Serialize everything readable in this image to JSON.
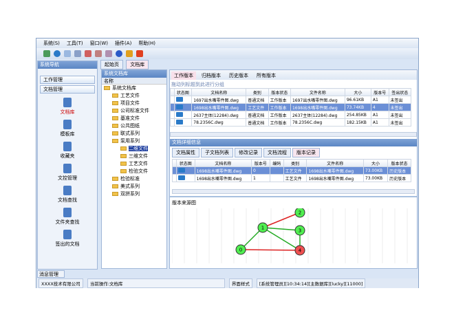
{
  "menu": [
    "系统(S)",
    "工具(T)",
    "窗口(W)",
    "插件(A)",
    "帮助(H)"
  ],
  "nav": {
    "title": "系统导航",
    "groups": [
      "工作管理",
      "文档管理"
    ],
    "items": [
      "文档库",
      "模板库",
      "收藏夹",
      "文控管理",
      "文档查找",
      "文件夹查找",
      "签出的文档"
    ],
    "bottom_tab": "消息管理"
  },
  "tabs": [
    "起始页",
    "文档库"
  ],
  "tree": {
    "title": "系统文档库",
    "header": "名称",
    "items": [
      {
        "label": "系统文档库",
        "level": 0
      },
      {
        "label": "工艺文件",
        "level": 1
      },
      {
        "label": "项目文件",
        "level": 1
      },
      {
        "label": "公司标准文件",
        "level": 1
      },
      {
        "label": "基准文件",
        "level": 1
      },
      {
        "label": "公共图纸",
        "level": 1
      },
      {
        "label": "联式系列",
        "level": 1
      },
      {
        "label": "泵用系列",
        "level": 1
      },
      {
        "label": "二维文件",
        "level": 2,
        "selected": true
      },
      {
        "label": "三维文件",
        "level": 2
      },
      {
        "label": "工艺文件",
        "level": 2
      },
      {
        "label": "检验文件",
        "level": 2
      },
      {
        "label": "检验标准",
        "level": 1
      },
      {
        "label": "美式系列",
        "level": 1
      },
      {
        "label": "双拼系列",
        "level": 1
      }
    ]
  },
  "versions": {
    "buttons": [
      "工作版本",
      "归档版本",
      "历史版本",
      "所有版本"
    ],
    "group_hint": "拖动列标题到此进行分组",
    "columns": [
      "状态图",
      "文档名称",
      "类别",
      "版本状态",
      "文件名称",
      "大小",
      "版本号",
      "签出状态"
    ],
    "rows": [
      [
        "",
        "1697出水嘴零件图.dwg",
        "普通文档",
        "工作版本",
        "1697出水嘴零件图.dwg",
        "96.61KB",
        "A1",
        "未签出"
      ],
      [
        "",
        "1698出水嘴零件图.dwg",
        "工艺文件",
        "工作版本",
        "1698出水嘴零件图.dwg",
        "73.74KB",
        "4",
        "未签出"
      ],
      [
        "",
        "2637主体(12284).dwg",
        "普通文档",
        "工作版本",
        "2637主体(12284).dwg",
        "254.85KB",
        "A1",
        "未签出"
      ],
      [
        "",
        "78.2356C.dwg",
        "普通文档",
        "工作版本",
        "78.2356C.dwg",
        "182.15KB",
        "A1",
        "未签出"
      ]
    ],
    "selected_row": 1
  },
  "detail": {
    "title": "文档详细信息",
    "tabs": [
      "文档属性",
      "子文档列表",
      "修改记录",
      "文档流程",
      "版本记录"
    ],
    "active_tab": 4,
    "columns": [
      "状态图",
      "文档名称",
      "版本号",
      "编码",
      "类别",
      "文件名称",
      "大小",
      "版本状态"
    ],
    "rows": [
      [
        "",
        "1698出水嘴零件图.dwg",
        "0",
        "",
        "工艺文件",
        "1698出水嘴零件图.dwg",
        "73.00KB",
        "历史版本"
      ],
      [
        "",
        "1698出水嘴零件图.dwg",
        "1",
        "",
        "工艺文件",
        "1698出水嘴零件图.dwg",
        "73.00KB",
        "历史版本"
      ]
    ],
    "graph_title": "版本来源图",
    "graph": {
      "nodes": [
        "0",
        "1",
        "2",
        "3",
        "4"
      ],
      "edges": [
        [
          "0",
          "1",
          "#22aa22"
        ],
        [
          "1",
          "2",
          "#dd2222"
        ],
        [
          "1",
          "3",
          "#22aa22"
        ],
        [
          "0",
          "4",
          "#dd2222"
        ],
        [
          "3",
          "4",
          "#22aa22"
        ],
        [
          "1",
          "4",
          "#22aa22"
        ]
      ]
    }
  },
  "status": {
    "company": "XXXX技术有限公司",
    "op": "当前操作:文档库",
    "style": "界面样式",
    "info": "[系统管理员][10:34:14][主数据库][lucky][11000]"
  }
}
